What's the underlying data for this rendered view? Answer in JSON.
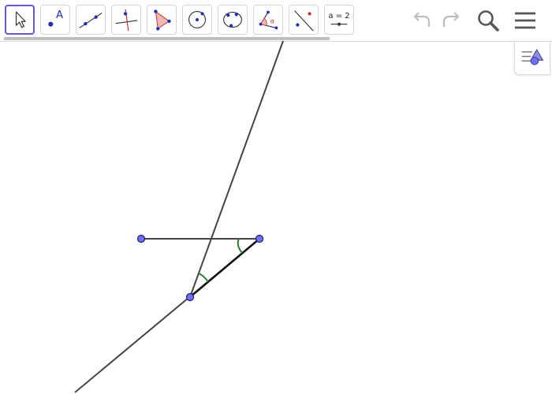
{
  "toolbar": {
    "tools": [
      {
        "name": "move-tool",
        "icon": "arrow-cursor-icon",
        "selected": true
      },
      {
        "name": "point-tool",
        "icon": "point-icon"
      },
      {
        "name": "line-tool",
        "icon": "line-icon"
      },
      {
        "name": "perpendicular-line-tool",
        "icon": "perpendicular-line-icon"
      },
      {
        "name": "polygon-tool",
        "icon": "polygon-icon"
      },
      {
        "name": "circle-with-center-tool",
        "icon": "circle-center-icon"
      },
      {
        "name": "circle-through-points-tool",
        "icon": "circle-three-points-icon"
      },
      {
        "name": "angle-tool",
        "icon": "angle-icon"
      },
      {
        "name": "reflect-tool",
        "icon": "reflect-about-line-icon"
      },
      {
        "name": "slider-tool",
        "icon": "slider-icon",
        "label": "a = 2"
      }
    ],
    "undo_icon": "undo-icon",
    "redo_icon": "redo-icon",
    "search_icon": "search-icon",
    "menu_icon": "hamburger-menu-icon"
  },
  "style_bar_toggle_icon": "style-bar-icon",
  "colors": {
    "accent": "#6557d2",
    "point_fill": "#6f6ff7",
    "point_stroke": "#1b1b6e",
    "line": "#444444",
    "angle": "#2e7d32",
    "polygon_fill": "#f4b5b5"
  }
}
